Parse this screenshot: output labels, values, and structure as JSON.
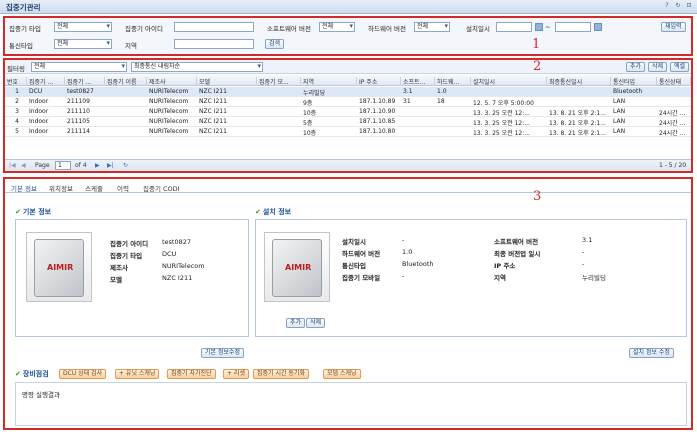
{
  "window": {
    "title": "집중기관리",
    "tools": [
      "?",
      "↻",
      "⊡"
    ]
  },
  "search": {
    "type_label": "집중기 타입",
    "type_value": "전체",
    "id_label": "집중기 아이디",
    "id_value": "",
    "sw_label": "소프트웨어 버전",
    "sw_value": "전체",
    "hw_label": "하드웨어 버전",
    "hw_value": "전체",
    "date_label": "설치일시",
    "date_sep": "~",
    "reset_label": "재입력",
    "comm_label": "통신타입",
    "comm_value": "전체",
    "region_label": "지역",
    "region_value": "",
    "search_label": "검색"
  },
  "section_numbers": [
    "1",
    "2",
    "3"
  ],
  "grid": {
    "filter_label": "필터링",
    "filter_value": "전체",
    "sort_value": "최종통신 내림차순",
    "add_label": "추가",
    "delete_label": "삭제",
    "excel_label": "엑셀",
    "columns": [
      "번호",
      "집중기 ...",
      "집중기 ...",
      "집중기 이름",
      "제조사",
      "모델",
      "집중기 모...",
      "지역",
      "IP 주소",
      "소프트...",
      "하드웨...",
      "설치일시",
      "최종통신일시",
      "통신타입",
      "통신상태"
    ],
    "rows": [
      [
        "1",
        "DCU",
        "test0827",
        "",
        "NURITelecom",
        "NZC I211",
        "",
        "누리빌딩",
        "",
        "3.1",
        "1.0",
        "",
        "",
        "Bluetooth",
        ""
      ],
      [
        "2",
        "Indoor",
        "211109",
        "",
        "NURITelecom",
        "NZC I211",
        "",
        "9층",
        "187.1.10.89",
        "31",
        "18",
        "12. 5. 7 오후 5:00:00",
        "",
        "LAN",
        ""
      ],
      [
        "3",
        "Indoor",
        "211110",
        "",
        "NURITelecom",
        "NZC I211",
        "",
        "10층",
        "187.1.10.90",
        "",
        "",
        "13. 3. 25 오전 12:...",
        "13. 8. 21 오후 2:1...",
        "LAN",
        "24시간 ..."
      ],
      [
        "4",
        "Indoor",
        "211105",
        "",
        "NURITelecom",
        "NZC I211",
        "",
        "5층",
        "187.1.10.85",
        "",
        "",
        "13. 3. 25 오전 12:...",
        "13. 8. 21 오후 2:1...",
        "LAN",
        "24시간 ..."
      ],
      [
        "5",
        "Indoor",
        "211114",
        "",
        "NURITelecom",
        "NZC I211",
        "",
        "10층",
        "187.1.10.80",
        "",
        "",
        "13. 3. 25 오전 12:...",
        "13. 8. 21 오후 2:1...",
        "LAN",
        "24시간 ..."
      ]
    ],
    "pager": {
      "page_label": "Page",
      "page_value": "1",
      "of_label": "of 4",
      "range": "1 - 5 / 20"
    }
  },
  "detail": {
    "tabs": [
      "기본 정보",
      "위치정보",
      "스케줄",
      "이력",
      "집중기 CODI"
    ],
    "basic": {
      "title": "기본 정보",
      "fields": [
        {
          "k": "집중기 아이디",
          "v": "test0827"
        },
        {
          "k": "집중기 타입",
          "v": "DCU"
        },
        {
          "k": "제조사",
          "v": "NURITelecom"
        },
        {
          "k": "모델",
          "v": "NZC I211"
        }
      ],
      "edit_label": "기본 정보수정",
      "brand": "AIMIR"
    },
    "install": {
      "title": "설치 정보",
      "left": [
        {
          "k": "설치일시",
          "v": "-"
        },
        {
          "k": "하드웨어 버전",
          "v": "1.0"
        },
        {
          "k": "통신타입",
          "v": "Bluetooth"
        },
        {
          "k": "집중기 모바일",
          "v": "-"
        }
      ],
      "right": [
        {
          "k": "소프트웨어 버전",
          "v": "3.1"
        },
        {
          "k": "최종 버전업 일시",
          "v": "-"
        },
        {
          "k": "IP 주소",
          "v": "-"
        },
        {
          "k": "지역",
          "v": "누리빌딩"
        }
      ],
      "add_label": "추가",
      "delete_label": "삭제",
      "edit_label": "설치 정보 수정",
      "brand": "AIMIR"
    },
    "equip": {
      "title": "장비점검",
      "buttons": [
        "DCU 상태 검사",
        "+ 유닛 스캐닝",
        "집중기 자가진단",
        "+ 리셋",
        "집중기 시간 동기화",
        "모뎀 스캐닝"
      ],
      "result": "명령 실행결과"
    }
  },
  "colors": {
    "accent": "#1a4f95",
    "marker": "#d62828",
    "check": "#3a9a2a"
  }
}
